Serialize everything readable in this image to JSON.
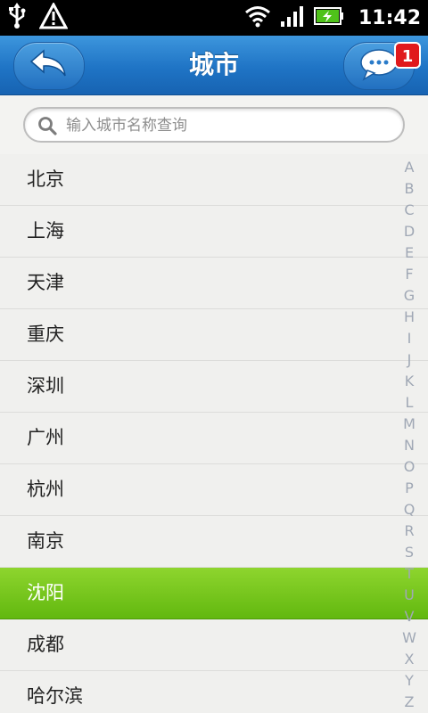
{
  "status_bar": {
    "time": "11:42",
    "icons": [
      "usb-icon",
      "warning-icon",
      "wifi-icon",
      "signal-icon",
      "battery-charging-icon"
    ]
  },
  "header": {
    "title": "城市",
    "back_icon": "back-arrow-icon",
    "message_icon": "chat-bubble-icon",
    "message_badge": "1"
  },
  "search": {
    "placeholder": "输入城市名称查询",
    "value": ""
  },
  "cities": [
    {
      "name": "北京",
      "selected": false
    },
    {
      "name": "上海",
      "selected": false
    },
    {
      "name": "天津",
      "selected": false
    },
    {
      "name": "重庆",
      "selected": false
    },
    {
      "name": "深圳",
      "selected": false
    },
    {
      "name": "广州",
      "selected": false
    },
    {
      "name": "杭州",
      "selected": false
    },
    {
      "name": "南京",
      "selected": false
    },
    {
      "name": "沈阳",
      "selected": true
    },
    {
      "name": "成都",
      "selected": false
    },
    {
      "name": "哈尔滨",
      "selected": false
    }
  ],
  "index_letters": [
    "A",
    "B",
    "C",
    "D",
    "E",
    "F",
    "G",
    "H",
    "I",
    "J",
    "K",
    "L",
    "M",
    "N",
    "O",
    "P",
    "Q",
    "R",
    "S",
    "T",
    "U",
    "V",
    "W",
    "X",
    "Y",
    "Z"
  ],
  "colors": {
    "header_blue": "#1f74c5",
    "selected_green": "#6cc21a",
    "badge_red": "#e0191c"
  }
}
